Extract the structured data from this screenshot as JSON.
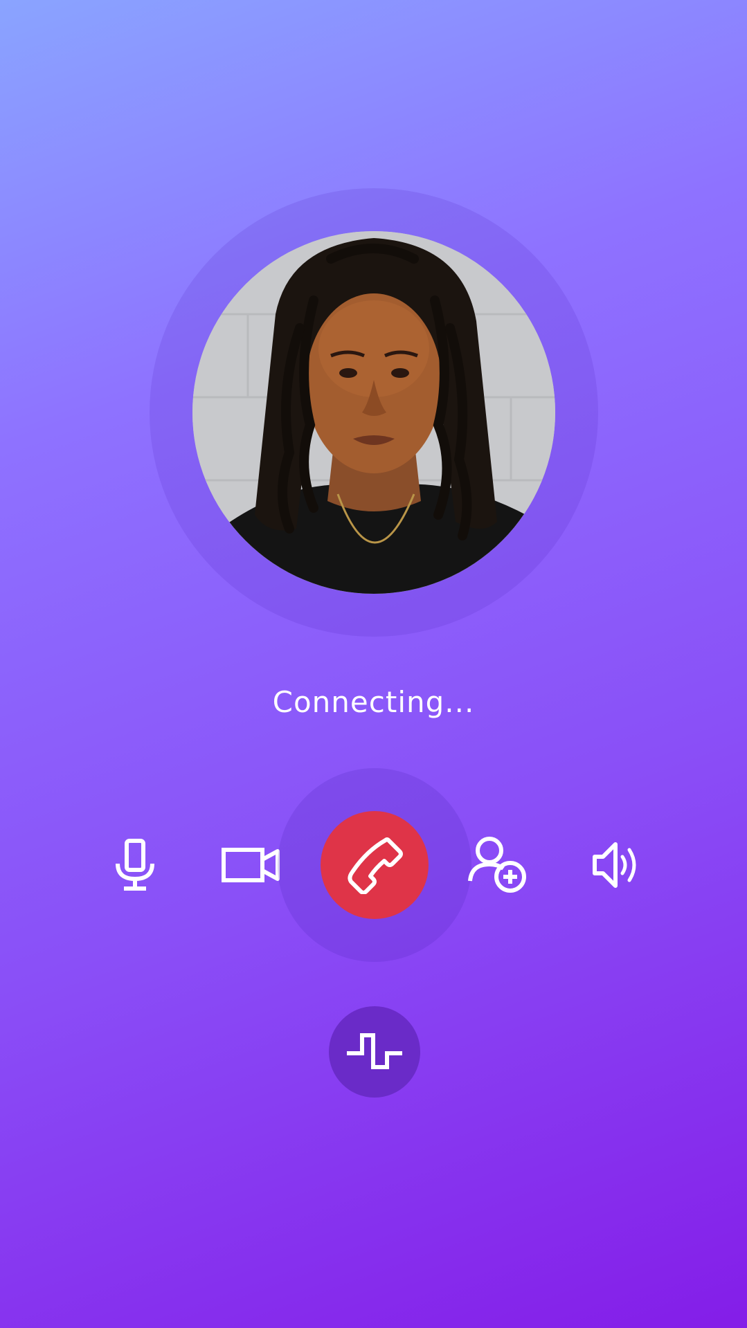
{
  "call": {
    "status_text": "Connecting...",
    "state": "connecting"
  },
  "controls": {
    "mute": {
      "icon": "microphone-icon"
    },
    "video": {
      "icon": "video-camera-icon"
    },
    "end_call": {
      "icon": "phone-hangup-icon",
      "color": "#df3448"
    },
    "add_person": {
      "icon": "add-person-icon"
    },
    "speaker": {
      "icon": "speaker-icon"
    },
    "keypad_tone": {
      "icon": "pulse-wave-icon"
    }
  },
  "colors": {
    "gradient_start": "#8aa4ff",
    "gradient_end": "#841de8",
    "icon": "#ffffff",
    "end_call": "#df3448"
  }
}
